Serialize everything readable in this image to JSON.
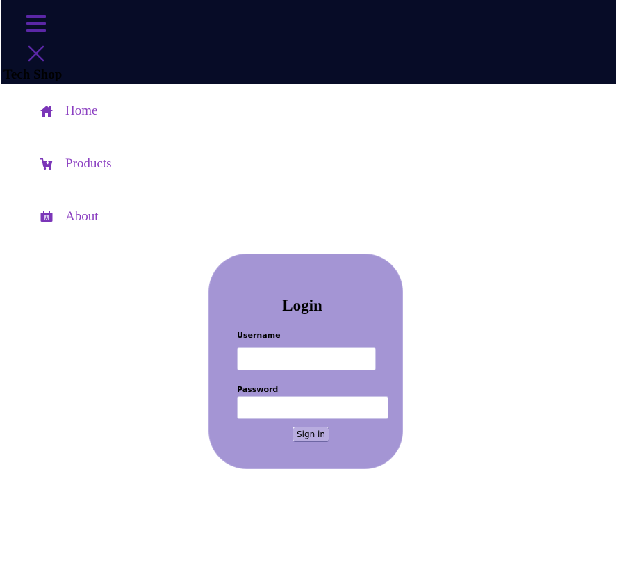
{
  "header": {
    "menu_icon": "hamburger-menu-icon",
    "close_icon": "close-icon",
    "brand": "Tech Shop",
    "background_color": "#070c27",
    "icon_color": "#5b27a6"
  },
  "nav": {
    "items": [
      {
        "label": "Home",
        "icon": "home-icon"
      },
      {
        "label": "Products",
        "icon": "cart-plus-icon"
      },
      {
        "label": "About",
        "icon": "calendar-badge-icon"
      }
    ],
    "color": "#8b3fc1"
  },
  "login": {
    "title": "Login",
    "username_label": "Username",
    "username_value": "",
    "password_label": "Password",
    "password_value": "",
    "submit_label": "Sign in",
    "card_color": "#a495d4"
  }
}
